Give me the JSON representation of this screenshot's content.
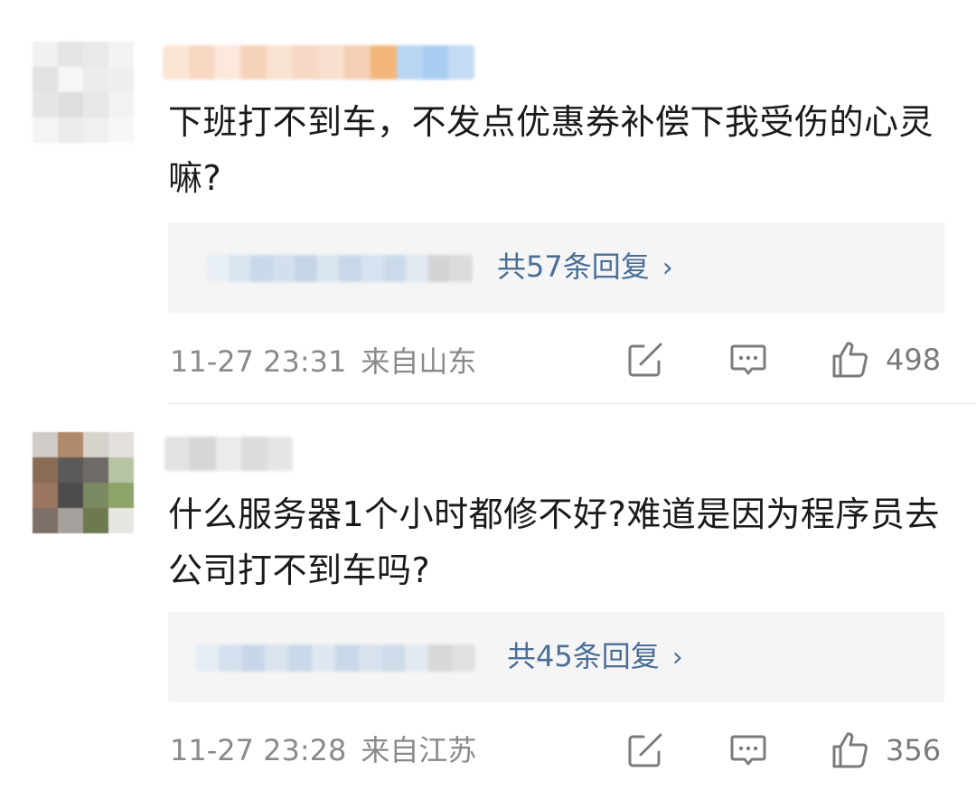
{
  "comments": [
    {
      "text": "下班打不到车，不发点优惠券补偿下我受伤的心灵嘛?",
      "replies_label": "共57条回复",
      "timestamp": "11-27 23:31",
      "location": "来自山东",
      "likes": "498",
      "icons": [
        "share-icon",
        "comment-icon",
        "like-icon",
        "chevron-right-icon"
      ]
    },
    {
      "text": "什么服务器1个小时都修不好?难道是因为程序员去公司打不到车吗?",
      "replies_label": "共45条回复",
      "timestamp": "11-27 23:28",
      "location": "来自江苏",
      "likes": "356",
      "icons": [
        "share-icon",
        "comment-icon",
        "like-icon",
        "chevron-right-icon"
      ]
    }
  ],
  "colors": {
    "text": "#1a1a1a",
    "meta": "#8a8a8a",
    "link": "#4a6e96",
    "reply_bg": "#f5f5f5"
  }
}
